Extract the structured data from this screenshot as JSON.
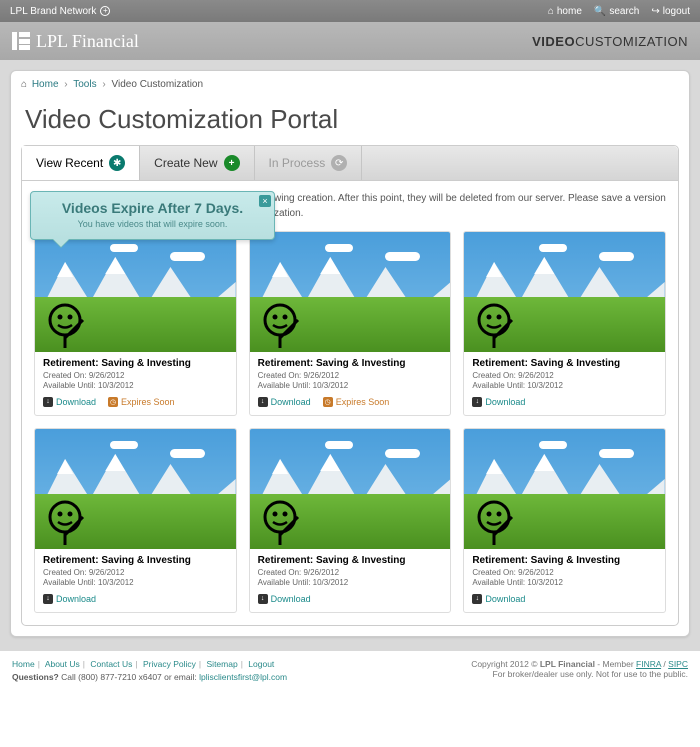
{
  "topbar": {
    "network_label": "LPL Brand Network",
    "links": {
      "home": "home",
      "search": "search",
      "logout": "logout"
    }
  },
  "header": {
    "logo_text": "LPL Financial",
    "right_bold": "VIDEO",
    "right_light": "CUSTOMIZATION"
  },
  "breadcrumb": {
    "home": "Home",
    "tools": "Tools",
    "current": "Video Customization"
  },
  "page_title": "Video Customization Portal",
  "tabs": {
    "recent": "View Recent",
    "create": "Create New",
    "process": "In Process"
  },
  "notice_tail": "wing creation. After this point, they will be deleted from our server. Please save a version",
  "notice_tail2": "zation.",
  "tooltip": {
    "title": "Videos Expire After 7 Days.",
    "body": "You have videos that will expire soon."
  },
  "card": {
    "title": "Retirement: Saving & Investing",
    "created_label": "Created On: ",
    "created_date": "9/26/2012",
    "avail_label": "Available Until: ",
    "avail_date": "10/3/2012",
    "download": "Download",
    "expires": "Expires Soon"
  },
  "footer": {
    "links": {
      "home": "Home",
      "about": "About Us",
      "contact": "Contact Us",
      "privacy": "Privacy Policy",
      "sitemap": "Sitemap",
      "logout": "Logout"
    },
    "q_label": "Questions?",
    "q_text": " Call (800) 877-7210 x6407 or email: ",
    "q_email": "lplisclientsfirst@lpl.com",
    "copyright": "Copyright 2012 © ",
    "co_name": "LPL Financial",
    "member": "  -  Member ",
    "finra": "FINRA",
    "slash": " / ",
    "sipc": "SIPC",
    "disclaimer": "For broker/dealer use only. Not for use to the public."
  }
}
